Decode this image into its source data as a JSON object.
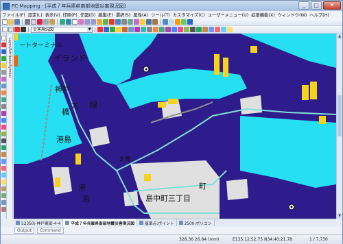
{
  "window": {
    "title": "PC-Mapping - [平成７年兵庫県南部地震災害現況図]",
    "btn_min": "_",
    "btn_max": "□",
    "btn_close": "✕"
  },
  "menu": [
    "ファイル(F)",
    "設定(L)",
    "表示(V)",
    "印刷(P)",
    "作図(D)",
    "編集(E)",
    "選択(S)",
    "属性(A)",
    "ツール(T)",
    "カスタマイズ(C)",
    "ユーザーメニュー(U)",
    "拡張機能(X)",
    "ウィンドウ(W)",
    "ヘルプ(H)"
  ],
  "toolbar": {
    "layer_combo_value": "災害現況図"
  },
  "side_panel": {
    "label": "Layer/Attribute/Symbol"
  },
  "map_labels": {
    "terminal": "ートターミナル",
    "ireland": "イランド",
    "dai": "大",
    "kobe": "神戸",
    "hashi": "橋",
    "sen": "線",
    "minato": "港島",
    "ko": "港",
    "shima": "島",
    "hiroba": "ま島",
    "nakamachi": "島中町三丁目",
    "machi": "町"
  },
  "doc_tabs": [
    "52350) 神戸東部-4-4",
    "平成７年兵庫県南部地震災害現況図",
    "基準点:ポイント",
    "2500:ポリゴン"
  ],
  "output_tabs": [
    "Output",
    "Command"
  ],
  "status": {
    "scale": "328.36 26.84 (mm)",
    "coords": "E135:12:52.75 N34:40:21.78",
    "ratio": "1 / 7,730"
  },
  "colors": {
    "land": "#2f1c8c",
    "sea": "#27dff2",
    "building_yellow": "#f6d21b",
    "road": "#7fe0d6",
    "block": "#e0e0e0"
  }
}
